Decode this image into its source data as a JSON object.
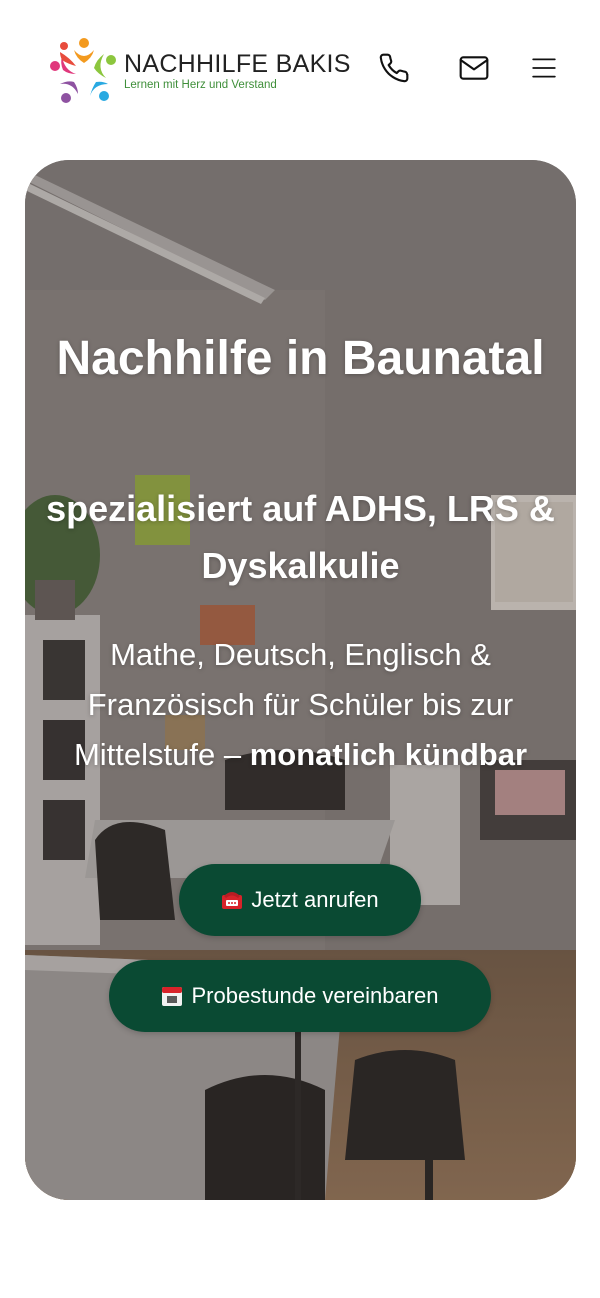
{
  "header": {
    "brand_name": "NACHHILFE BAKIS",
    "brand_tagline": "Lernen mit Herz und Verstand",
    "phone_icon": "phone-icon",
    "mail_icon": "mail-icon",
    "menu_icon": "menu-icon"
  },
  "hero": {
    "title": "Nachhilfe in Baunatal",
    "subtitle": "spezialisiert auf ADHS, LRS & Dyskalkulie",
    "description_plain": "Mathe, Deutsch, Englisch & Französisch für Schüler bis zur Mittelstufe –",
    "description_bold": "monatlich kündbar",
    "cta_call_label": "Jetzt anrufen",
    "cta_call_icon": "telephone-emoji-icon",
    "cta_trial_label": "Probestunde vereinbaren",
    "cta_trial_icon": "calendar-emoji-icon"
  },
  "colors": {
    "button_bg": "#0a4a33",
    "brand_text": "#222222",
    "tagline": "#3f8f3a"
  }
}
